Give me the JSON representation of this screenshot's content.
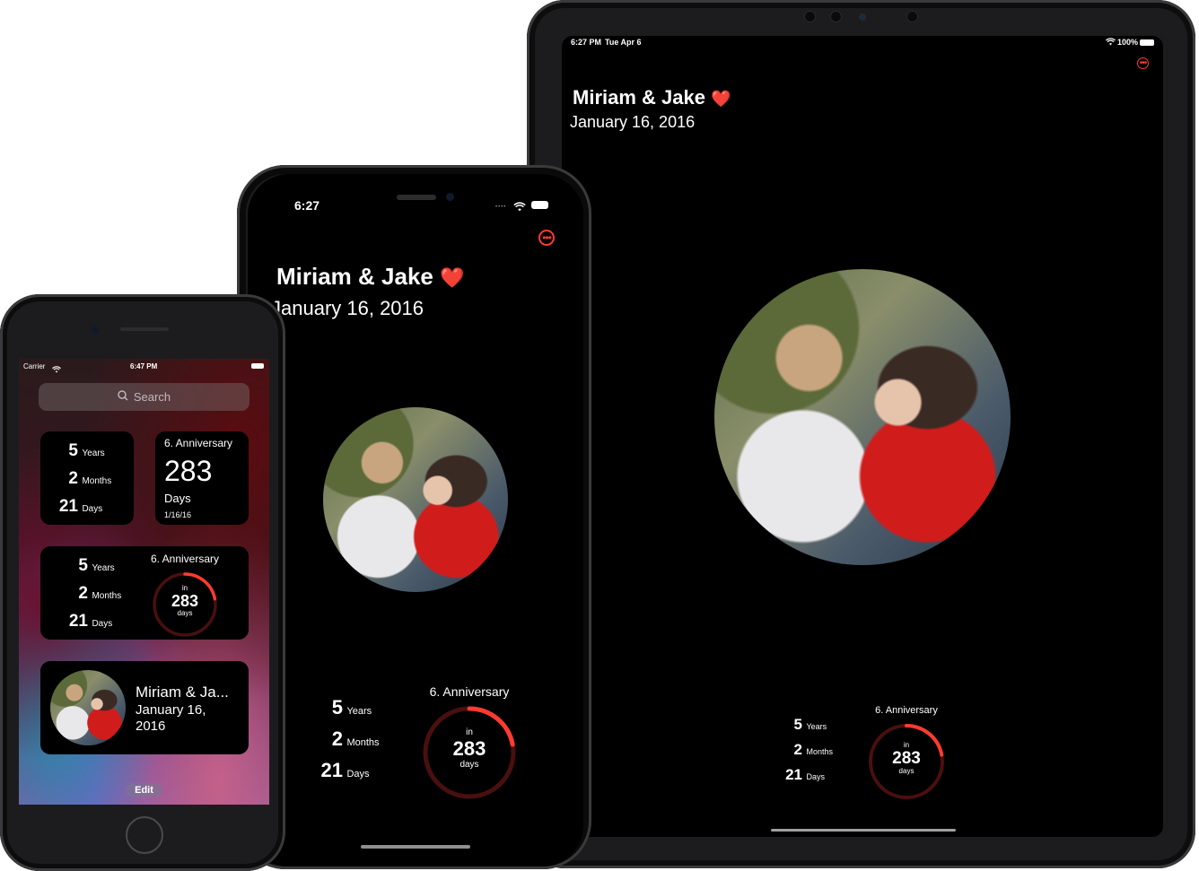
{
  "couple": {
    "title": "Miriam & Jake",
    "heart": "❤️",
    "date": "January 16, 2016"
  },
  "stats": {
    "years_value": "5",
    "years_label": "Years",
    "months_value": "2",
    "months_label": "Months",
    "days_value": "21",
    "days_label": "Days"
  },
  "anniversary": {
    "label": "6. Anniversary",
    "in_label": "in",
    "days_remaining": "283",
    "days_label": "days",
    "progress": 0.22
  },
  "ipad": {
    "status_time": "6:27 PM",
    "status_date": "Tue Apr 6",
    "battery": "100%"
  },
  "iphone12": {
    "status_time": "6:27"
  },
  "iphonese": {
    "carrier": "Carrier",
    "status_time": "6:47 PM",
    "search_placeholder": "Search",
    "widget_anniv_days": "283",
    "widget_anniv_days_label": "Days",
    "widget_anniv_date": "1/16/16",
    "widget_title_short": "Miriam & Ja...",
    "widget_date_line1": "January 16,",
    "widget_date_line2": "2016",
    "edit_label": "Edit"
  },
  "colors": {
    "accent": "#ff3b30",
    "ring_track": "#4a0f0f",
    "background": "#000000"
  }
}
